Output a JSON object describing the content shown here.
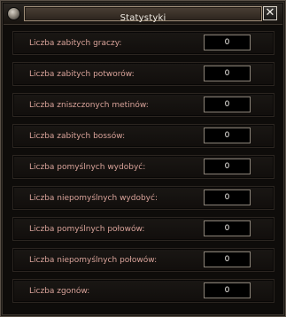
{
  "window": {
    "title": "Statystyki",
    "close_glyph": "✕"
  },
  "icons": {
    "pin": "pin-icon",
    "close": "close-icon"
  },
  "colors": {
    "label_text": "#d9a39a",
    "value_text": "#f4f1ec",
    "background": "#0e0c0a"
  },
  "stats": [
    {
      "label": "Liczba zabitych graczy:",
      "value": "0"
    },
    {
      "label": "Liczba zabitych potworów:",
      "value": "0"
    },
    {
      "label": "Liczba zniszczonych metinów:",
      "value": "0"
    },
    {
      "label": "Liczba zabitych bossów:",
      "value": "0"
    },
    {
      "label": "Liczba pomyślnych wydobyć:",
      "value": "0"
    },
    {
      "label": "Liczba niepomyślnych wydobyć:",
      "value": "0"
    },
    {
      "label": "Liczba pomyślnych połowów:",
      "value": "0"
    },
    {
      "label": "Liczba niepomyślnych połowów:",
      "value": "0"
    },
    {
      "label": "Liczba zgonów:",
      "value": "0"
    }
  ]
}
